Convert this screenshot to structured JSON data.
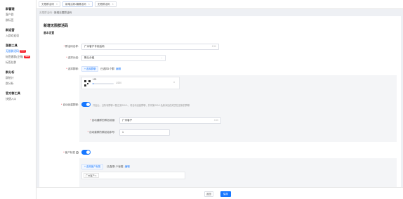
{
  "sidebar": {
    "groups": [
      {
        "title": "群管理",
        "items": [
          "客户群",
          "群标签"
        ]
      },
      {
        "title": "群运营",
        "items": [
          "入群欢迎语"
        ]
      },
      {
        "title": "涨群工具",
        "items": [
          {
            "label": "无限群活码",
            "badge": "NEW",
            "active": true
          },
          {
            "label": "标签建群(企微)",
            "badge": "NEW"
          },
          {
            "label": "标签拉群"
          }
        ]
      },
      {
        "title": "群分析",
        "items": [
          "群统计",
          "群分析"
        ]
      },
      {
        "title": "官方群工具",
        "items": [
          "快捷入口"
        ]
      }
    ]
  },
  "tabs": [
    {
      "label": "无限群活码"
    },
    {
      "label": "新增活码/编辑活码",
      "active": true
    },
    {
      "label": "无限群活码"
    }
  ],
  "breadcrumb": {
    "parent": "无限群活码",
    "sep": "/",
    "current": "新增无限群活码"
  },
  "page_title": "新增无限群活码",
  "section_title": "基本设置",
  "form": {
    "name": {
      "label": "群活码名称:",
      "value": "广州客户专用活码",
      "count": "8/15"
    },
    "group": {
      "label": "选择分组:",
      "value": "默认分组"
    },
    "groupchat": {
      "label": "选择群聊:",
      "button": "+ 选择群聊",
      "selected": "已选择1个群",
      "edit": "编辑",
      "card_name": "123",
      "card_progress": 0.02,
      "card_progress_text": "1/200",
      "close": "×"
    },
    "auto_create": {
      "label": "自动创建群聊:",
      "enabled": true,
      "hint": "开启后，当所有群聊人数达到200人，将自动创建群聊，并将第200人及新添加的成员拉进新的群聊",
      "name_label": "自动建群的群名前缀:",
      "name_value": "广州客户",
      "name_count": "4/15",
      "seq_label": "自动建群的群起始序号:",
      "seq_value": "1"
    },
    "customer_tag": {
      "label": "客户标签",
      "help": "?",
      "enabled": true,
      "button": "+ 选择客户标签",
      "selected": "已选择1个标签",
      "edit": "编辑",
      "tag": "广州客户",
      "tag_close": "×"
    }
  },
  "footer": {
    "cancel": "返回",
    "save": "保存"
  },
  "colors": {
    "accent": "#1677ff",
    "badge": "#f5222d"
  }
}
